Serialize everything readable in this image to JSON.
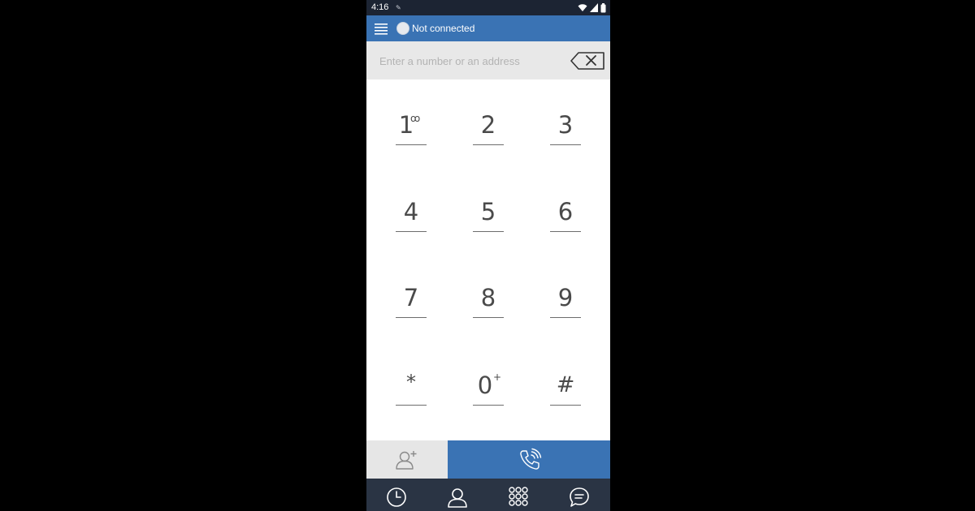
{
  "status_bar": {
    "time": "4:16",
    "indicator": "✎",
    "icons": [
      "wifi-icon",
      "signal-icon",
      "battery-icon"
    ]
  },
  "app_bar": {
    "menu_icon": "hamburger-icon",
    "connection_status": "Not connected"
  },
  "dial_input": {
    "value": "",
    "placeholder": "Enter a number or an address",
    "backspace_icon": "backspace-icon"
  },
  "keypad": {
    "keys": [
      {
        "digit": "1",
        "sup": "ꝏ"
      },
      {
        "digit": "2",
        "sup": ""
      },
      {
        "digit": "3",
        "sup": ""
      },
      {
        "digit": "4",
        "sup": ""
      },
      {
        "digit": "5",
        "sup": ""
      },
      {
        "digit": "6",
        "sup": ""
      },
      {
        "digit": "7",
        "sup": ""
      },
      {
        "digit": "8",
        "sup": ""
      },
      {
        "digit": "9",
        "sup": ""
      },
      {
        "digit": "*",
        "sup": ""
      },
      {
        "digit": "0",
        "sup": "+"
      },
      {
        "digit": "#",
        "sup": ""
      }
    ]
  },
  "actions": {
    "add_contact_icon": "add-contact-icon",
    "call_icon": "phone-call-icon"
  },
  "navbar": {
    "items": [
      "history-icon",
      "contacts-icon",
      "dialpad-icon",
      "chat-icon"
    ]
  },
  "colors": {
    "accent": "#3a73b4",
    "status_bar": "#1c2433",
    "navbar": "#2a3444",
    "input_bg": "#e8e8e8",
    "key_text": "#4a4a4a"
  }
}
